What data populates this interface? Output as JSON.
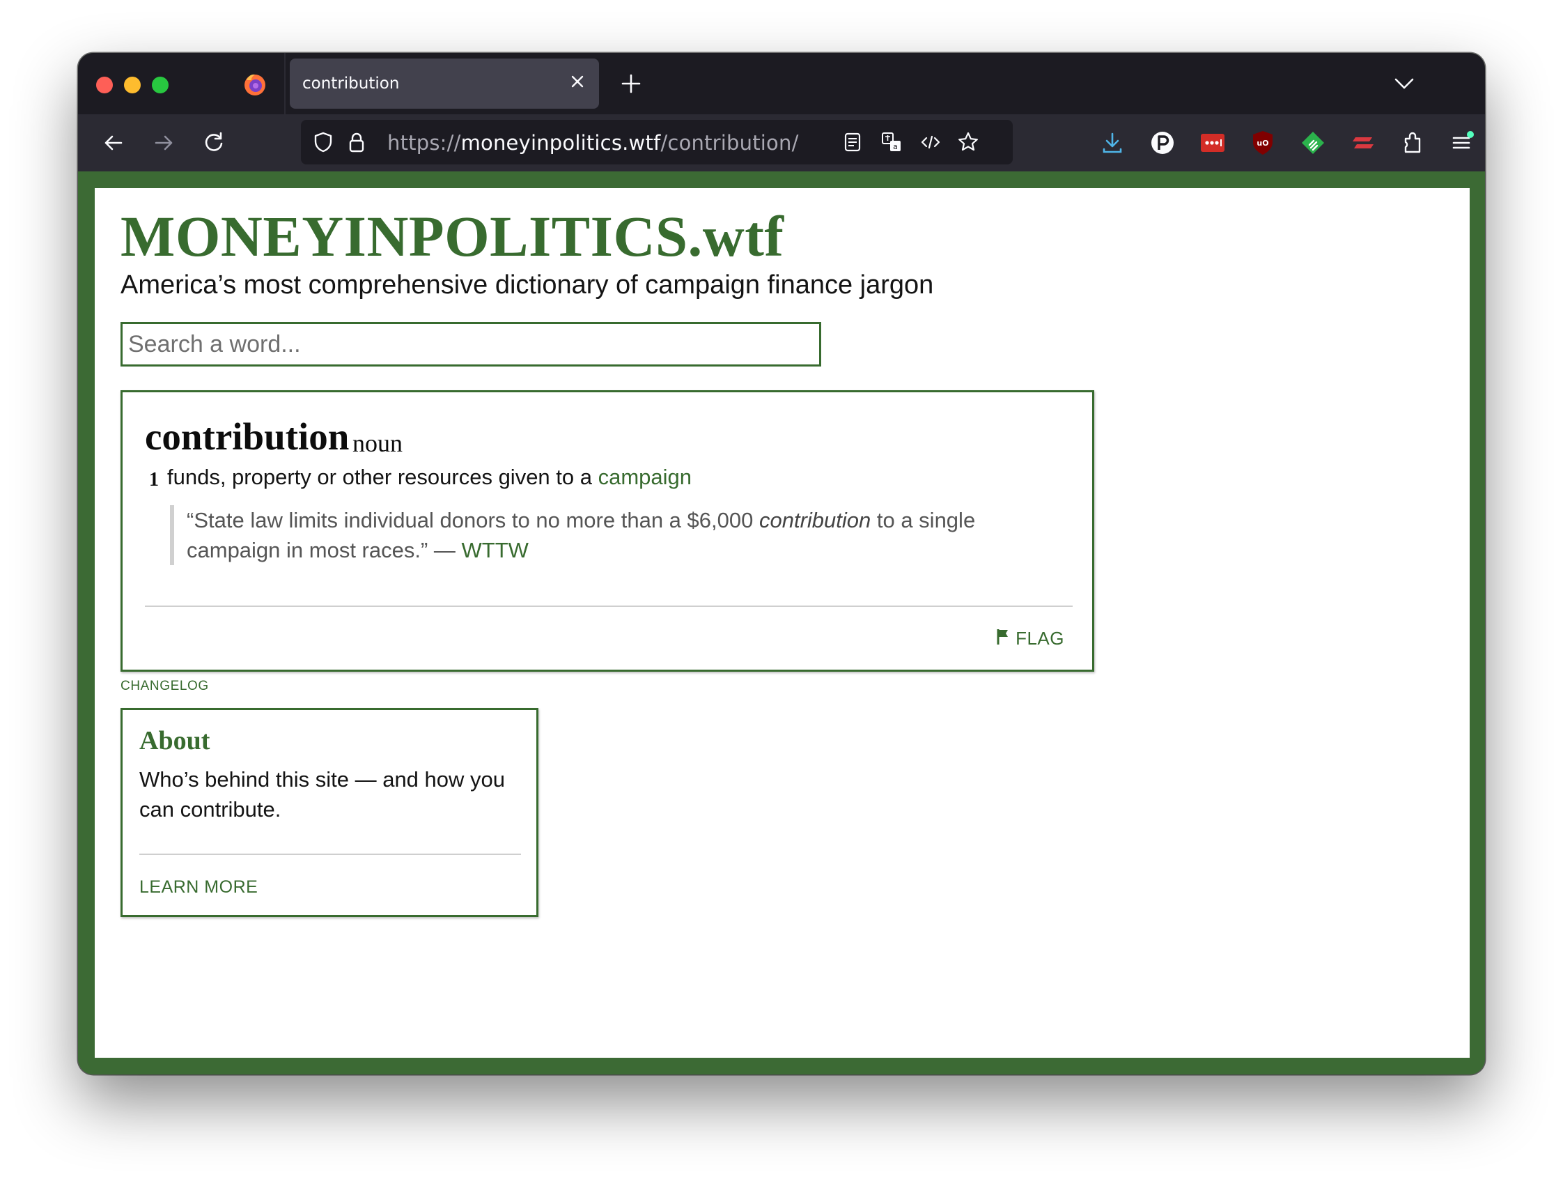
{
  "browser": {
    "tab_title": "contribution",
    "url_scheme": "https://",
    "url_host": "moneyinpolitics.wtf",
    "url_path": "/contribution/"
  },
  "site": {
    "title": "MONEYINPOLITICS.wtf",
    "tagline": "America’s most comprehensive dictionary of campaign finance jargon",
    "search_placeholder": "Search a word..."
  },
  "entry": {
    "word": "contribution",
    "part_of_speech": "noun",
    "sense_number": "1",
    "definition_text": "funds, property or other resources given to a ",
    "definition_link": "campaign",
    "quote_open": "“State law limits individual donors to no more than a $6,000 ",
    "quote_term": "contribution",
    "quote_close": " to a single campaign in most races.” — ",
    "quote_source": "WTTW",
    "flag_label": "FLAG"
  },
  "changelog_label": "CHANGELOG",
  "about": {
    "title": "About",
    "text": "Who’s behind this site — and how you can contribute.",
    "link_label": "LEARN MORE"
  },
  "colors": {
    "brand_green": "#386b2f",
    "browser_dark": "#1c1b22",
    "toolbar": "#2b2a33"
  }
}
